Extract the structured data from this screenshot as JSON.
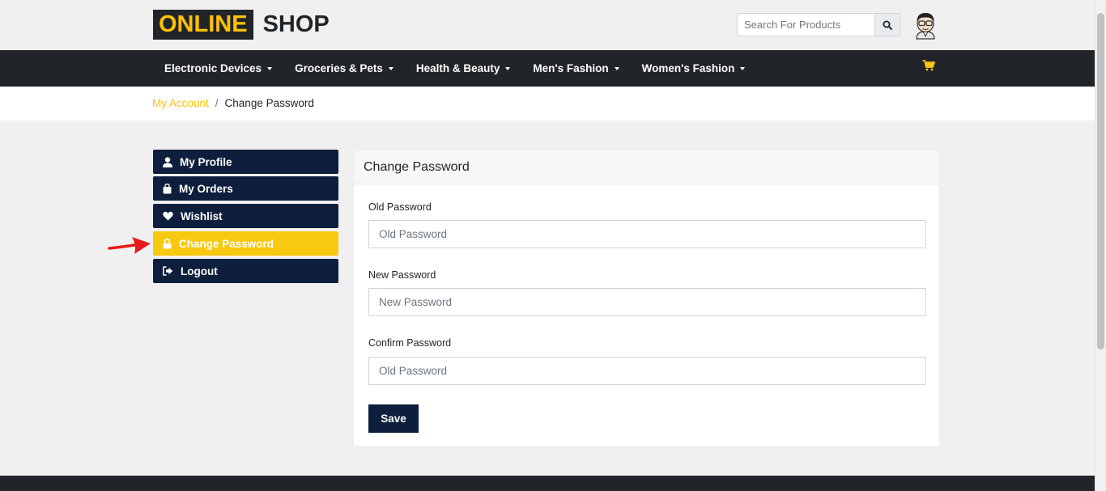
{
  "header": {
    "logo_highlight": "ONLINE",
    "logo_text": "SHOP",
    "search_placeholder": "Search For Products"
  },
  "nav": {
    "items": [
      {
        "label": "Electronic Devices"
      },
      {
        "label": "Groceries & Pets"
      },
      {
        "label": "Health & Beauty"
      },
      {
        "label": "Men's Fashion"
      },
      {
        "label": "Women's Fashion"
      }
    ]
  },
  "breadcrumb": {
    "parent": "My Account",
    "separator": "/",
    "current": "Change Password"
  },
  "sidebar": {
    "items": [
      {
        "label": "My Profile",
        "icon": "user-icon"
      },
      {
        "label": "My Orders",
        "icon": "shopping-bag-icon"
      },
      {
        "label": "Wishlist",
        "icon": "heart-icon"
      },
      {
        "label": "Change Password",
        "icon": "lock-icon",
        "active": true
      },
      {
        "label": "Logout",
        "icon": "sign-out-icon"
      }
    ]
  },
  "form": {
    "title": "Change Password",
    "old_password": {
      "label": "Old Password",
      "placeholder": "Old Password",
      "value": ""
    },
    "new_password": {
      "label": "New Password",
      "placeholder": "New Password",
      "value": ""
    },
    "confirm_password": {
      "label": "Confirm Password",
      "placeholder": "Old Password",
      "value": ""
    },
    "save_label": "Save"
  },
  "colors": {
    "accent": "#f7c910",
    "navy": "#0d1f3c",
    "dark": "#212529",
    "annotation_arrow": "#e81a1a"
  }
}
